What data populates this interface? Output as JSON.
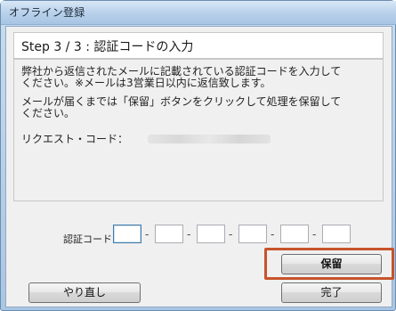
{
  "window": {
    "title": "オフライン登録"
  },
  "step": {
    "title": "Step 3 / 3 : 認証コードの入力"
  },
  "content": {
    "paragraph1": "弊社から返信されたメールに記載されている認証コードを入力して\nください。※メールは3営業日以内に返信致します。",
    "paragraph2": "メールが届くまでは「保留」ボタンをクリックして処理を保留して\nください。",
    "request_code_label": "リクエスト・コード："
  },
  "auth": {
    "label": "認証コード",
    "fields": [
      "",
      "",
      "",
      "",
      "",
      ""
    ],
    "separator": "-"
  },
  "buttons": {
    "hold": "保留",
    "redo": "やり直し",
    "done": "完了"
  },
  "colors": {
    "highlight": "#c7532c",
    "titlebar": "#b7d0ea"
  }
}
